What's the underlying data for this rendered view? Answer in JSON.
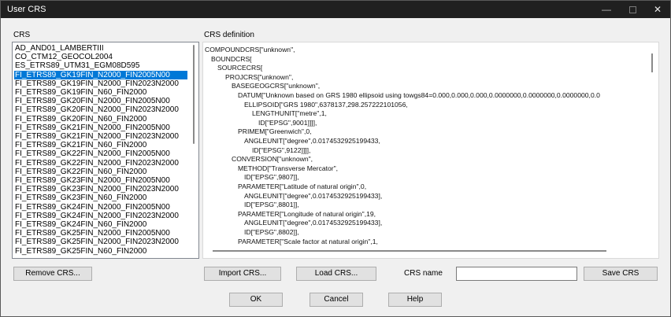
{
  "window": {
    "title": "User CRS",
    "minimize_glyph": "—",
    "close_glyph": "✕"
  },
  "labels": {
    "crs": "CRS",
    "crs_definition": "CRS definition",
    "crs_name": "CRS name"
  },
  "crs_list": {
    "items": [
      "AD_AND01_LAMBERTIII",
      "CO_CTM12_GEOCOL2004",
      "ES_ETRS89_UTM31_EGM08D595",
      "FI_ETRS89_GK19FIN_N2000_FIN2005N00",
      "FI_ETRS89_GK19FIN_N2000_FIN2023N2000",
      "FI_ETRS89_GK19FIN_N60_FIN2000",
      "FI_ETRS89_GK20FIN_N2000_FIN2005N00",
      "FI_ETRS89_GK20FIN_N2000_FIN2023N2000",
      "FI_ETRS89_GK20FIN_N60_FIN2000",
      "FI_ETRS89_GK21FIN_N2000_FIN2005N00",
      "FI_ETRS89_GK21FIN_N2000_FIN2023N2000",
      "FI_ETRS89_GK21FIN_N60_FIN2000",
      "FI_ETRS89_GK22FIN_N2000_FIN2005N00",
      "FI_ETRS89_GK22FIN_N2000_FIN2023N2000",
      "FI_ETRS89_GK22FIN_N60_FIN2000",
      "FI_ETRS89_GK23FIN_N2000_FIN2005N00",
      "FI_ETRS89_GK23FIN_N2000_FIN2023N2000",
      "FI_ETRS89_GK23FIN_N60_FIN2000",
      "FI_ETRS89_GK24FIN_N2000_FIN2005N00",
      "FI_ETRS89_GK24FIN_N2000_FIN2023N2000",
      "FI_ETRS89_GK24FIN_N60_FIN2000",
      "FI_ETRS89_GK25FIN_N2000_FIN2005N00",
      "FI_ETRS89_GK25FIN_N2000_FIN2023N2000",
      "FI_ETRS89_GK25FIN_N60_FIN2000"
    ],
    "selected_index": 3
  },
  "crs_definition": {
    "lines": [
      "COMPOUNDCRS[\"unknown\",",
      "BOUNDCRS[",
      "SOURCECRS[",
      "PROJCRS[\"unknown\",",
      "BASEGEOGCRS[\"unknown\",",
      "DATUM[\"Unknown based on GRS 1980 ellipsoid using towgs84=0.000,0.000,0.000,0.0000000,0.0000000,0.0000000,0.0",
      "ELLIPSOID[\"GRS 1980\",6378137,298.257222101056,",
      "LENGTHUNIT[\"metre\",1,",
      "ID[\"EPSG\",9001]]]],",
      "PRIMEM[\"Greenwich\",0,",
      "ANGLEUNIT[\"degree\",0.0174532925199433,",
      "ID[\"EPSG\",9122]]]],",
      "CONVERSION[\"unknown\",",
      "METHOD[\"Transverse Mercator\",",
      "ID[\"EPSG\",9807]],",
      "PARAMETER[\"Latitude of natural origin\",0,",
      "ANGLEUNIT[\"degree\",0.0174532925199433],",
      "ID[\"EPSG\",8801]],",
      "PARAMETER[\"Longitude of natural origin\",19,",
      "ANGLEUNIT[\"degree\",0.0174532925199433],",
      "ID[\"EPSG\",8802]],",
      "PARAMETER[\"Scale factor at natural origin\",1,"
    ]
  },
  "buttons": {
    "remove_crs": "Remove CRS...",
    "import_crs": "Import CRS...",
    "load_crs": "Load CRS...",
    "save_crs": "Save CRS",
    "ok": "OK",
    "cancel": "Cancel",
    "help": "Help"
  },
  "crs_name_field": {
    "value": ""
  },
  "colors": {
    "selection": "#0078d7",
    "titlebar": "#202020"
  }
}
